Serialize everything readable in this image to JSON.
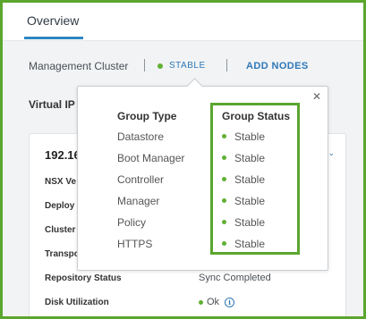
{
  "tabs": [
    {
      "label": "Overview",
      "active": true
    }
  ],
  "management": {
    "label": "Management Cluster",
    "status": "STABLE",
    "add_nodes": "ADD NODES"
  },
  "virtual_ip_label": "Virtual IP",
  "node_card": {
    "ip": "192.16",
    "properties": [
      {
        "label": "NSX Ve",
        "value": ""
      },
      {
        "label": "Deploy",
        "value": ""
      },
      {
        "label": "Cluster",
        "value": ""
      },
      {
        "label": "Transpo",
        "value": ""
      },
      {
        "label": "Repository Status",
        "value": "Sync Completed"
      },
      {
        "label": "Disk Utilization",
        "value": "Ok"
      }
    ]
  },
  "popover": {
    "col_type": "Group Type",
    "col_status": "Group Status",
    "rows": [
      {
        "type": "Datastore",
        "status": "Stable"
      },
      {
        "type": "Boot Manager",
        "status": "Stable"
      },
      {
        "type": "Controller",
        "status": "Stable"
      },
      {
        "type": "Manager",
        "status": "Stable"
      },
      {
        "type": "Policy",
        "status": "Stable"
      },
      {
        "type": "HTTPS",
        "status": "Stable"
      }
    ]
  },
  "colors": {
    "accent": "#2e78b7",
    "status_green": "#61b033",
    "highlight_green": "#5aa62f"
  },
  "icons": {
    "close": "close-icon",
    "info": "info-icon",
    "chevron": "chevron-down-icon"
  }
}
